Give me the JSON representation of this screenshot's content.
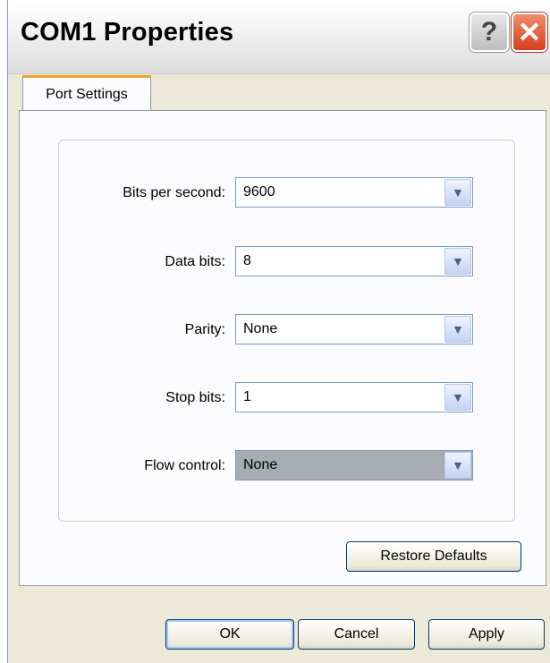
{
  "window": {
    "title": "COM1 Properties",
    "help_label": "?",
    "close_label": "✕"
  },
  "tabs": [
    {
      "label": "Port Settings",
      "active": true
    }
  ],
  "settings": {
    "rows": [
      {
        "label": "Bits per second:",
        "value": "9600"
      },
      {
        "label": "Data bits:",
        "value": "8"
      },
      {
        "label": "Parity:",
        "value": "None"
      },
      {
        "label": "Stop bits:",
        "value": "1"
      },
      {
        "label": "Flow control:",
        "value": "None"
      }
    ]
  },
  "buttons": {
    "restore_defaults": "Restore Defaults",
    "ok": "OK",
    "cancel": "Cancel",
    "apply": "Apply"
  },
  "icons": {
    "dropdown": "chevron-down-icon",
    "help": "question-icon",
    "close": "close-icon"
  },
  "colors": {
    "close_button": "#d4411c",
    "tab_highlight": "#f0a22e",
    "dialog_bg": "#ece9d8"
  }
}
